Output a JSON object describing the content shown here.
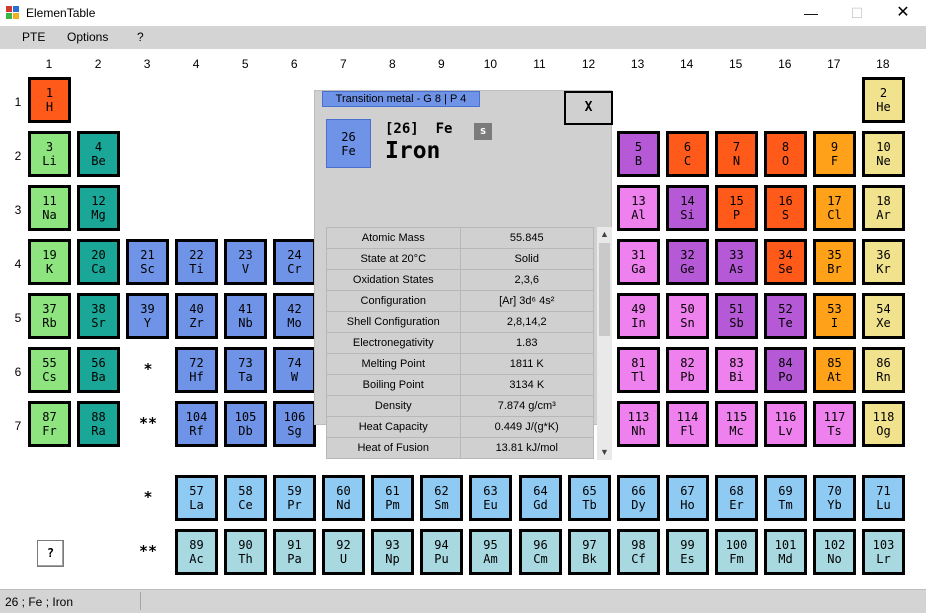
{
  "window": {
    "title": "ElemenTable",
    "minimize": "—",
    "maximize": "☐",
    "close": "✕"
  },
  "menu": [
    "PTE",
    "Options",
    "?"
  ],
  "colors": {
    "alkali": "#8ee57f",
    "alkaline": "#1aa798",
    "transition": "#6f93e7",
    "lanthanide": "#8fcaf3",
    "actinide": "#a8d8e0",
    "metalloid": "#b559d6",
    "reactive": "#ff5a1a",
    "halogen": "#ffa21a",
    "noble": "#f1e28e",
    "post": "#ef81ef",
    "unknown": "#ef81ef"
  },
  "groups": [
    "1",
    "2",
    "3",
    "4",
    "5",
    "6",
    "7",
    "8",
    "9",
    "10",
    "11",
    "12",
    "13",
    "14",
    "15",
    "16",
    "17",
    "18"
  ],
  "periods": [
    "1",
    "2",
    "3",
    "4",
    "5",
    "6",
    "7"
  ],
  "markers": {
    "lanthanide": "*",
    "actinide": "**"
  },
  "help_button": "?",
  "elements": [
    {
      "n": "1",
      "s": "H",
      "g": 1,
      "p": 1,
      "c": "reactive"
    },
    {
      "n": "2",
      "s": "He",
      "g": 18,
      "p": 1,
      "c": "noble"
    },
    {
      "n": "3",
      "s": "Li",
      "g": 1,
      "p": 2,
      "c": "alkali"
    },
    {
      "n": "4",
      "s": "Be",
      "g": 2,
      "p": 2,
      "c": "alkaline"
    },
    {
      "n": "5",
      "s": "B",
      "g": 13,
      "p": 2,
      "c": "metalloid"
    },
    {
      "n": "6",
      "s": "C",
      "g": 14,
      "p": 2,
      "c": "reactive"
    },
    {
      "n": "7",
      "s": "N",
      "g": 15,
      "p": 2,
      "c": "reactive"
    },
    {
      "n": "8",
      "s": "O",
      "g": 16,
      "p": 2,
      "c": "reactive"
    },
    {
      "n": "9",
      "s": "F",
      "g": 17,
      "p": 2,
      "c": "halogen"
    },
    {
      "n": "10",
      "s": "Ne",
      "g": 18,
      "p": 2,
      "c": "noble"
    },
    {
      "n": "11",
      "s": "Na",
      "g": 1,
      "p": 3,
      "c": "alkali"
    },
    {
      "n": "12",
      "s": "Mg",
      "g": 2,
      "p": 3,
      "c": "alkaline"
    },
    {
      "n": "13",
      "s": "Al",
      "g": 13,
      "p": 3,
      "c": "post"
    },
    {
      "n": "14",
      "s": "Si",
      "g": 14,
      "p": 3,
      "c": "metalloid"
    },
    {
      "n": "15",
      "s": "P",
      "g": 15,
      "p": 3,
      "c": "reactive"
    },
    {
      "n": "16",
      "s": "S",
      "g": 16,
      "p": 3,
      "c": "reactive"
    },
    {
      "n": "17",
      "s": "Cl",
      "g": 17,
      "p": 3,
      "c": "halogen"
    },
    {
      "n": "18",
      "s": "Ar",
      "g": 18,
      "p": 3,
      "c": "noble"
    },
    {
      "n": "19",
      "s": "K",
      "g": 1,
      "p": 4,
      "c": "alkali"
    },
    {
      "n": "20",
      "s": "Ca",
      "g": 2,
      "p": 4,
      "c": "alkaline"
    },
    {
      "n": "21",
      "s": "Sc",
      "g": 3,
      "p": 4,
      "c": "transition"
    },
    {
      "n": "22",
      "s": "Ti",
      "g": 4,
      "p": 4,
      "c": "transition"
    },
    {
      "n": "23",
      "s": "V",
      "g": 5,
      "p": 4,
      "c": "transition"
    },
    {
      "n": "24",
      "s": "Cr",
      "g": 6,
      "p": 4,
      "c": "transition"
    },
    {
      "n": "31",
      "s": "Ga",
      "g": 13,
      "p": 4,
      "c": "post"
    },
    {
      "n": "32",
      "s": "Ge",
      "g": 14,
      "p": 4,
      "c": "metalloid"
    },
    {
      "n": "33",
      "s": "As",
      "g": 15,
      "p": 4,
      "c": "metalloid"
    },
    {
      "n": "34",
      "s": "Se",
      "g": 16,
      "p": 4,
      "c": "reactive"
    },
    {
      "n": "35",
      "s": "Br",
      "g": 17,
      "p": 4,
      "c": "halogen"
    },
    {
      "n": "36",
      "s": "Kr",
      "g": 18,
      "p": 4,
      "c": "noble"
    },
    {
      "n": "37",
      "s": "Rb",
      "g": 1,
      "p": 5,
      "c": "alkali"
    },
    {
      "n": "38",
      "s": "Sr",
      "g": 2,
      "p": 5,
      "c": "alkaline"
    },
    {
      "n": "39",
      "s": "Y",
      "g": 3,
      "p": 5,
      "c": "transition"
    },
    {
      "n": "40",
      "s": "Zr",
      "g": 4,
      "p": 5,
      "c": "transition"
    },
    {
      "n": "41",
      "s": "Nb",
      "g": 5,
      "p": 5,
      "c": "transition"
    },
    {
      "n": "42",
      "s": "Mo",
      "g": 6,
      "p": 5,
      "c": "transition"
    },
    {
      "n": "49",
      "s": "In",
      "g": 13,
      "p": 5,
      "c": "post"
    },
    {
      "n": "50",
      "s": "Sn",
      "g": 14,
      "p": 5,
      "c": "post"
    },
    {
      "n": "51",
      "s": "Sb",
      "g": 15,
      "p": 5,
      "c": "metalloid"
    },
    {
      "n": "52",
      "s": "Te",
      "g": 16,
      "p": 5,
      "c": "metalloid"
    },
    {
      "n": "53",
      "s": "I",
      "g": 17,
      "p": 5,
      "c": "halogen"
    },
    {
      "n": "54",
      "s": "Xe",
      "g": 18,
      "p": 5,
      "c": "noble"
    },
    {
      "n": "55",
      "s": "Cs",
      "g": 1,
      "p": 6,
      "c": "alkali"
    },
    {
      "n": "56",
      "s": "Ba",
      "g": 2,
      "p": 6,
      "c": "alkaline"
    },
    {
      "n": "72",
      "s": "Hf",
      "g": 4,
      "p": 6,
      "c": "transition"
    },
    {
      "n": "73",
      "s": "Ta",
      "g": 5,
      "p": 6,
      "c": "transition"
    },
    {
      "n": "74",
      "s": "W",
      "g": 6,
      "p": 6,
      "c": "transition"
    },
    {
      "n": "81",
      "s": "Tl",
      "g": 13,
      "p": 6,
      "c": "post"
    },
    {
      "n": "82",
      "s": "Pb",
      "g": 14,
      "p": 6,
      "c": "post"
    },
    {
      "n": "83",
      "s": "Bi",
      "g": 15,
      "p": 6,
      "c": "post"
    },
    {
      "n": "84",
      "s": "Po",
      "g": 16,
      "p": 6,
      "c": "metalloid"
    },
    {
      "n": "85",
      "s": "At",
      "g": 17,
      "p": 6,
      "c": "halogen"
    },
    {
      "n": "86",
      "s": "Rn",
      "g": 18,
      "p": 6,
      "c": "noble"
    },
    {
      "n": "87",
      "s": "Fr",
      "g": 1,
      "p": 7,
      "c": "alkali"
    },
    {
      "n": "88",
      "s": "Ra",
      "g": 2,
      "p": 7,
      "c": "alkaline"
    },
    {
      "n": "104",
      "s": "Rf",
      "g": 4,
      "p": 7,
      "c": "transition"
    },
    {
      "n": "105",
      "s": "Db",
      "g": 5,
      "p": 7,
      "c": "transition"
    },
    {
      "n": "106",
      "s": "Sg",
      "g": 6,
      "p": 7,
      "c": "transition"
    },
    {
      "n": "113",
      "s": "Nh",
      "g": 13,
      "p": 7,
      "c": "unknown"
    },
    {
      "n": "114",
      "s": "Fl",
      "g": 14,
      "p": 7,
      "c": "unknown"
    },
    {
      "n": "115",
      "s": "Mc",
      "g": 15,
      "p": 7,
      "c": "unknown"
    },
    {
      "n": "116",
      "s": "Lv",
      "g": 16,
      "p": 7,
      "c": "unknown"
    },
    {
      "n": "117",
      "s": "Ts",
      "g": 17,
      "p": 7,
      "c": "unknown"
    },
    {
      "n": "118",
      "s": "Og",
      "g": 18,
      "p": 7,
      "c": "noble"
    },
    {
      "n": "57",
      "s": "La",
      "g": 4,
      "p": 8,
      "c": "lanthanide"
    },
    {
      "n": "58",
      "s": "Ce",
      "g": 5,
      "p": 8,
      "c": "lanthanide"
    },
    {
      "n": "59",
      "s": "Pr",
      "g": 6,
      "p": 8,
      "c": "lanthanide"
    },
    {
      "n": "60",
      "s": "Nd",
      "g": 7,
      "p": 8,
      "c": "lanthanide"
    },
    {
      "n": "61",
      "s": "Pm",
      "g": 8,
      "p": 8,
      "c": "lanthanide"
    },
    {
      "n": "62",
      "s": "Sm",
      "g": 9,
      "p": 8,
      "c": "lanthanide"
    },
    {
      "n": "63",
      "s": "Eu",
      "g": 10,
      "p": 8,
      "c": "lanthanide"
    },
    {
      "n": "64",
      "s": "Gd",
      "g": 11,
      "p": 8,
      "c": "lanthanide"
    },
    {
      "n": "65",
      "s": "Tb",
      "g": 12,
      "p": 8,
      "c": "lanthanide"
    },
    {
      "n": "66",
      "s": "Dy",
      "g": 13,
      "p": 8,
      "c": "lanthanide"
    },
    {
      "n": "67",
      "s": "Ho",
      "g": 14,
      "p": 8,
      "c": "lanthanide"
    },
    {
      "n": "68",
      "s": "Er",
      "g": 15,
      "p": 8,
      "c": "lanthanide"
    },
    {
      "n": "69",
      "s": "Tm",
      "g": 16,
      "p": 8,
      "c": "lanthanide"
    },
    {
      "n": "70",
      "s": "Yb",
      "g": 17,
      "p": 8,
      "c": "lanthanide"
    },
    {
      "n": "71",
      "s": "Lu",
      "g": 18,
      "p": 8,
      "c": "lanthanide"
    },
    {
      "n": "89",
      "s": "Ac",
      "g": 4,
      "p": 9,
      "c": "actinide"
    },
    {
      "n": "90",
      "s": "Th",
      "g": 5,
      "p": 9,
      "c": "actinide"
    },
    {
      "n": "91",
      "s": "Pa",
      "g": 6,
      "p": 9,
      "c": "actinide"
    },
    {
      "n": "92",
      "s": "U",
      "g": 7,
      "p": 9,
      "c": "actinide"
    },
    {
      "n": "93",
      "s": "Np",
      "g": 8,
      "p": 9,
      "c": "actinide"
    },
    {
      "n": "94",
      "s": "Pu",
      "g": 9,
      "p": 9,
      "c": "actinide"
    },
    {
      "n": "95",
      "s": "Am",
      "g": 10,
      "p": 9,
      "c": "actinide"
    },
    {
      "n": "96",
      "s": "Cm",
      "g": 11,
      "p": 9,
      "c": "actinide"
    },
    {
      "n": "97",
      "s": "Bk",
      "g": 12,
      "p": 9,
      "c": "actinide"
    },
    {
      "n": "98",
      "s": "Cf",
      "g": 13,
      "p": 9,
      "c": "actinide"
    },
    {
      "n": "99",
      "s": "Es",
      "g": 14,
      "p": 9,
      "c": "actinide"
    },
    {
      "n": "100",
      "s": "Fm",
      "g": 15,
      "p": 9,
      "c": "actinide"
    },
    {
      "n": "101",
      "s": "Md",
      "g": 16,
      "p": 9,
      "c": "actinide"
    },
    {
      "n": "102",
      "s": "No",
      "g": 17,
      "p": 9,
      "c": "actinide"
    },
    {
      "n": "103",
      "s": "Lr",
      "g": 18,
      "p": 9,
      "c": "actinide"
    }
  ],
  "popup": {
    "category": "Transition metal - G 8 | P 4",
    "close_label": "X",
    "number": "26",
    "symbol": "Fe",
    "header": "[26]  Fe",
    "s_button": "s",
    "name": "Iron",
    "properties": [
      {
        "label": "Atomic Mass",
        "value": "55.845"
      },
      {
        "label": "State at 20°C",
        "value": "Solid"
      },
      {
        "label": "Oxidation States",
        "value": "2,3,6"
      },
      {
        "label": "Configuration",
        "value": "[Ar] 3d⁶ 4s²"
      },
      {
        "label": "Shell Configuration",
        "value": "2,8,14,2"
      },
      {
        "label": "Electronegativity",
        "value": "1.83"
      },
      {
        "label": "Melting Point",
        "value": "1811 K"
      },
      {
        "label": "Boiling Point",
        "value": "3134 K"
      },
      {
        "label": "Density",
        "value": "7.874 g/cm³"
      },
      {
        "label": "Heat Capacity",
        "value": "0.449 J/(g*K)"
      },
      {
        "label": "Heat of Fusion",
        "value": "13.81 kJ/mol"
      }
    ],
    "scroll_up": "▲",
    "scroll_down": "▼",
    "scroll_position": 0.0
  },
  "status": "26 ; Fe ; Iron"
}
